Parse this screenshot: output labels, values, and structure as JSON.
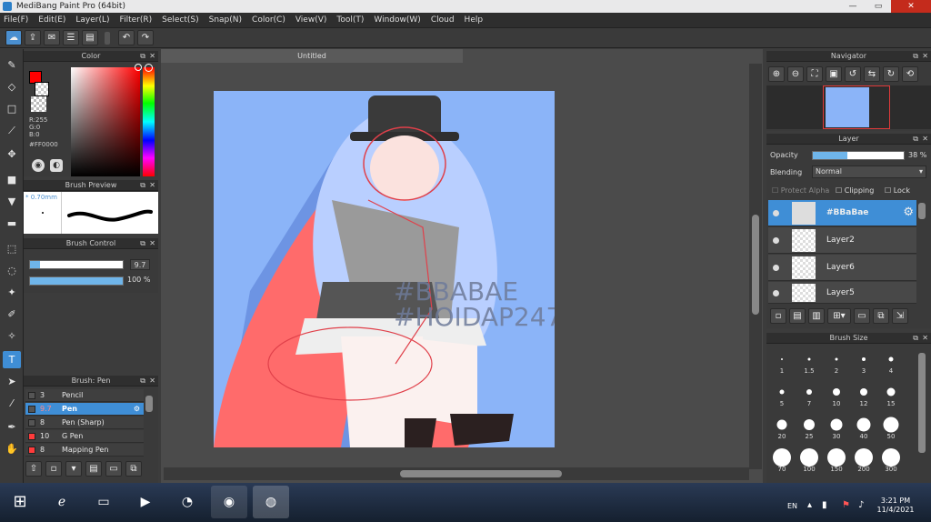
{
  "window": {
    "title": "MediBang Paint Pro (64bit)",
    "minimize": "—",
    "maximize": "▭",
    "close": "✕"
  },
  "menu": [
    "File(F)",
    "Edit(E)",
    "Layer(L)",
    "Filter(R)",
    "Select(S)",
    "Snap(N)",
    "Color(C)",
    "View(V)",
    "Tool(T)",
    "Window(W)",
    "Cloud",
    "Help"
  ],
  "color_panel": {
    "title": "Color",
    "r": "R:255",
    "g": "G:0",
    "b": "B:0",
    "hex": "#FF0000",
    "fg_color": "#ff0000"
  },
  "brush_preview": {
    "title": "Brush Preview",
    "size": "* 0.70mm"
  },
  "brush_control": {
    "title": "Brush Control",
    "size_value": "9.7",
    "size_fraction": 0.11,
    "opacity_value": "100 %",
    "opacity_fraction": 1.0
  },
  "brush_list": {
    "title": "Brush: Pen",
    "items": [
      {
        "num": "3",
        "name": "Pencil",
        "color": "#555555",
        "selected": false
      },
      {
        "num": "9.7",
        "name": "Pen",
        "color": "#555555",
        "selected": true
      },
      {
        "num": "8",
        "name": "Pen (Sharp)",
        "color": "#555555",
        "selected": false
      },
      {
        "num": "10",
        "name": "G Pen",
        "color": "#ff3b3b",
        "selected": false
      },
      {
        "num": "8",
        "name": "Mapping Pen",
        "color": "#ff3b3b",
        "selected": false
      }
    ]
  },
  "document": {
    "tab": "Untitled",
    "watermark_line1": "#BBABAE",
    "watermark_line2": "#HOIDAP247"
  },
  "navigator": {
    "title": "Navigator"
  },
  "layer_panel": {
    "title": "Layer",
    "opacity_label": "Opacity",
    "opacity_value": "38 %",
    "opacity_fraction": 0.38,
    "blending_label": "Blending",
    "blending_value": "Normal",
    "protect_alpha": "Protect Alpha",
    "clipping": "Clipping",
    "lock": "Lock",
    "layers": [
      {
        "name": "#BBaBae",
        "selected": true
      },
      {
        "name": "Layer2",
        "selected": false
      },
      {
        "name": "Layer6",
        "selected": false
      },
      {
        "name": "Layer5",
        "selected": false
      }
    ]
  },
  "brush_size": {
    "title": "Brush Size",
    "sizes": [
      "1",
      "1.5",
      "2",
      "3",
      "4",
      "5",
      "7",
      "10",
      "12",
      "15",
      "20",
      "25",
      "30",
      "40",
      "50",
      "70",
      "100",
      "150",
      "200",
      "300"
    ]
  },
  "taskbar": {
    "lang": "EN",
    "time": "3:21 PM",
    "date": "11/4/2021"
  }
}
